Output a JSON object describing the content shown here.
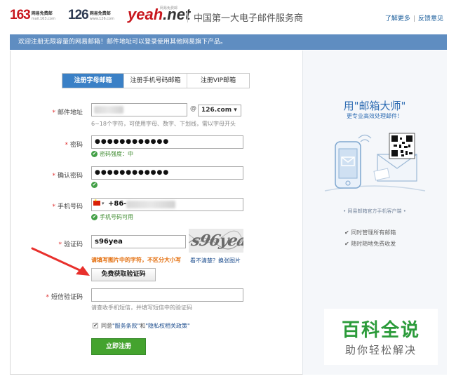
{
  "header": {
    "logo163": {
      "number": "163",
      "line1": "网易免费邮",
      "line2": "mail.163.com"
    },
    "logo126": {
      "number": "126",
      "line1": "网易免费邮",
      "line2": "www.126.com"
    },
    "logoyeah": {
      "yeah": "yeah",
      "net": ".net",
      "sup": "网易免费邮"
    },
    "slogan": "中国第一大电子邮件服务商",
    "links": [
      "了解更多",
      "反馈意见"
    ]
  },
  "notice": "欢迎注册无限容量的网易邮箱！邮件地址可以登录使用其他网易旗下产品。",
  "tabs": [
    {
      "label": "注册字母邮箱",
      "active": true
    },
    {
      "label": "注册手机号码邮箱",
      "active": false
    },
    {
      "label": "注册VIP邮箱",
      "active": false
    }
  ],
  "form": {
    "email": {
      "label": "邮件地址",
      "at": "@",
      "domain": "126.com",
      "hint": "6~18个字符，可使用字母、数字、下划线，需以字母开头"
    },
    "password": {
      "label": "密码",
      "value": "●●●●●●●●●●●●",
      "status": "密码强度：中"
    },
    "confirm": {
      "label": "确认密码",
      "value": "●●●●●●●●●●●●"
    },
    "phone": {
      "label": "手机号码",
      "prefix": "+86-",
      "status": "手机号码可用"
    },
    "captcha": {
      "label": "验证码",
      "value": "s96yea",
      "image_text": "s96yea",
      "hint": "请填写图片中的字符，不区分大小写",
      "refresh": "看不清楚？换张图片"
    },
    "get_code_button": "免费获取验证码",
    "sms": {
      "label": "短信验证码",
      "hint": "请查收手机短信，并填写短信中的验证码"
    },
    "agree": {
      "prefix": "同意",
      "terms": "\"服务条款\"",
      "and": "和",
      "privacy": "\"隐私权相关政策\"",
      "checked": "✔"
    },
    "submit": "立即注册",
    "required_mark": "*",
    "chevron": "▾"
  },
  "right_panel": {
    "title": "用\"邮箱大师\"",
    "subtitle": "更专业高效处理邮件！",
    "client_label": "• 网易邮箱官方手机客户端 •",
    "features": [
      "同时管理所有邮箱",
      "随时随地免费收发"
    ],
    "check": "✔"
  },
  "watermark": {
    "title": "百科全说",
    "subtitle": "助你轻松解决"
  },
  "colors": {
    "accent": "#3a80c6",
    "notice_bg": "#5f8dc1",
    "submit_green": "#44a32e",
    "error_red": "#e03333",
    "arrow_red": "#e8302c"
  }
}
